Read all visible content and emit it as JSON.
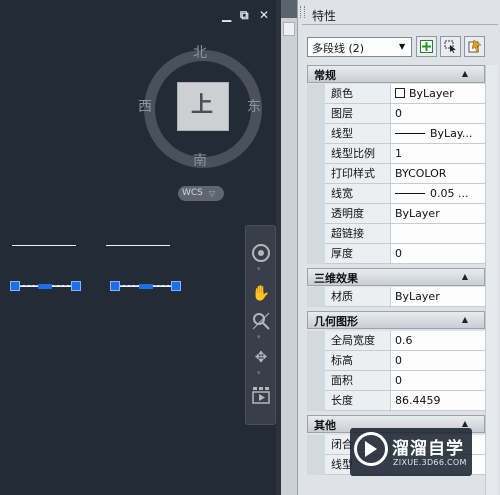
{
  "canvas": {
    "window_buttons": [
      "▁",
      "⧉",
      "✕"
    ],
    "viewcube": {
      "north": "北",
      "south": "南",
      "east": "东",
      "west": "西",
      "face": "上",
      "wcs_label": "WCS",
      "wcs_arrow": "▽"
    },
    "nav_tools": [
      "steering-wheel-icon",
      "pan-icon",
      "zoom-icon",
      "orbit-icon",
      "showmotion-icon"
    ]
  },
  "palette": {
    "title": "特性",
    "object_select": "多段线 (2)",
    "categories": [
      {
        "name": "常规",
        "rows": [
          {
            "name": "颜色",
            "value": "ByLayer",
            "swatch": true
          },
          {
            "name": "图层",
            "value": "0"
          },
          {
            "name": "线型",
            "value": "ByLay...",
            "line": true
          },
          {
            "name": "线型比例",
            "value": "1"
          },
          {
            "name": "打印样式",
            "value": "BYCOLOR"
          },
          {
            "name": "线宽",
            "value": "0.05 ...",
            "line": true
          },
          {
            "name": "透明度",
            "value": "ByLayer"
          },
          {
            "name": "超链接",
            "value": ""
          },
          {
            "name": "厚度",
            "value": "0"
          }
        ]
      },
      {
        "name": "三维效果",
        "rows": [
          {
            "name": "材质",
            "value": "ByLayer"
          }
        ]
      },
      {
        "name": "几何图形",
        "rows": [
          {
            "name": "全局宽度",
            "value": "0.6"
          },
          {
            "name": "标高",
            "value": "0"
          },
          {
            "name": "面积",
            "value": "0"
          },
          {
            "name": "长度",
            "value": "86.4459"
          }
        ]
      },
      {
        "name": "其他",
        "rows": [
          {
            "name": "闭合",
            "value": ""
          },
          {
            "name": "线型",
            "value": ""
          }
        ]
      }
    ]
  },
  "watermark": {
    "name": "溜溜自学",
    "url": "ZIXUE.3D66.COM"
  }
}
